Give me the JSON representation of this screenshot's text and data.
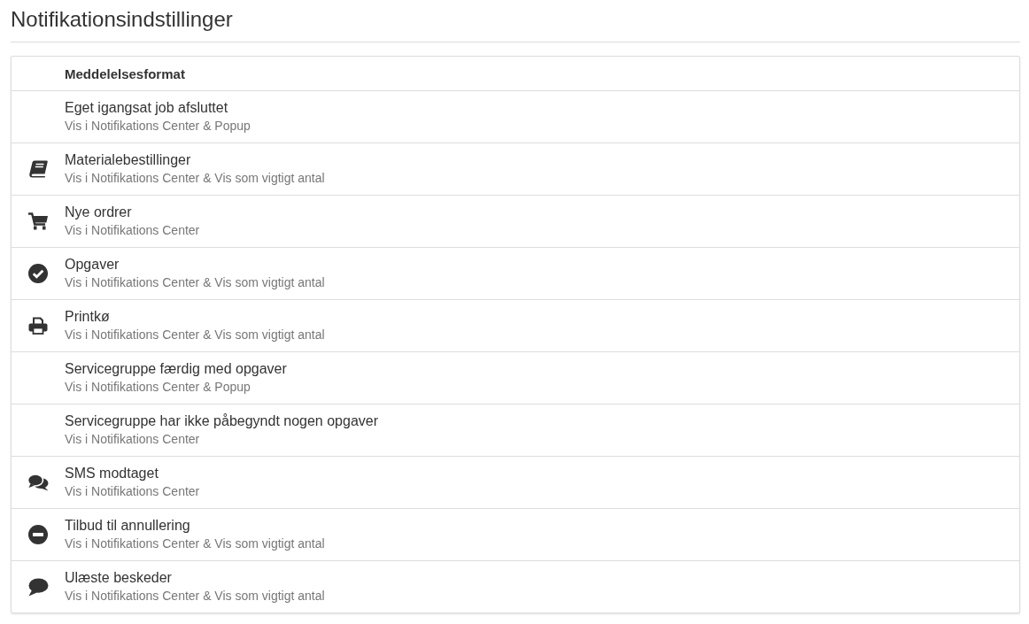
{
  "title": "Notifikationsindstillinger",
  "table": {
    "column_header": "Meddelelsesformat",
    "rows": [
      {
        "kind": "plain",
        "name": "Eget igangsat job afsluttet",
        "format": "Vis i Notifikations Center & Popup"
      },
      {
        "kind": "materials",
        "name": "Materialebestillinger",
        "format": "Vis i Notifikations Center & Vis som vigtigt antal"
      },
      {
        "kind": "orders",
        "name": "Nye ordrer",
        "format": "Vis i Notifikations Center"
      },
      {
        "kind": "tasks",
        "name": "Opgaver",
        "format": "Vis i Notifikations Center & Vis som vigtigt antal"
      },
      {
        "kind": "print",
        "name": "Printkø",
        "format": "Vis i Notifikations Center & Vis som vigtigt antal"
      },
      {
        "kind": "plain",
        "name": "Servicegruppe færdig med opgaver",
        "format": "Vis i Notifikations Center & Popup"
      },
      {
        "kind": "plain",
        "name": "Servicegruppe har ikke påbegyndt nogen opgaver",
        "format": "Vis i Notifikations Center"
      },
      {
        "kind": "sms",
        "name": "SMS modtaget",
        "format": "Vis i Notifikations Center"
      },
      {
        "kind": "cancellation",
        "name": "Tilbud til annullering",
        "format": "Vis i Notifikations Center & Vis som vigtigt antal"
      },
      {
        "kind": "messages",
        "name": "Ulæste beskeder",
        "format": "Vis i Notifikations Center & Vis som vigtigt antal"
      }
    ]
  }
}
